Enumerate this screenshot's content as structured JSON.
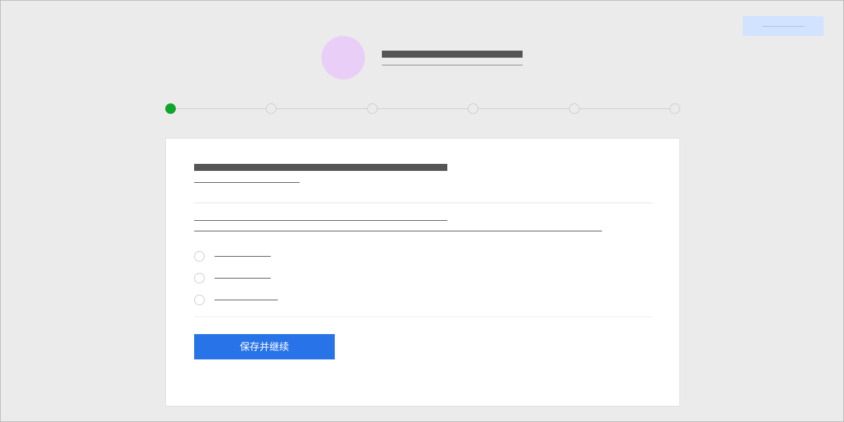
{
  "header": {
    "top_right_chip_label": "",
    "title": "",
    "subtitle": ""
  },
  "stepper": {
    "steps": [
      {
        "active": true
      },
      {
        "active": false
      },
      {
        "active": false
      },
      {
        "active": false
      },
      {
        "active": false
      },
      {
        "active": false
      }
    ]
  },
  "form": {
    "section_title": "",
    "section_subtitle": "",
    "question_text": "",
    "question_detail": "",
    "options": [
      {
        "label": ""
      },
      {
        "label": ""
      },
      {
        "label": ""
      }
    ],
    "save_button": "保存并继续"
  }
}
